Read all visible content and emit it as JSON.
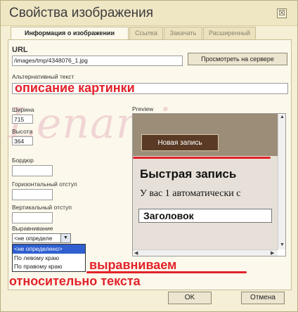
{
  "dialog": {
    "title": "Свойства изображения",
    "close_glyph": "☒"
  },
  "tabs": [
    {
      "label": "Информация о изображении",
      "active": true
    },
    {
      "label": "Ссылка",
      "active": false
    },
    {
      "label": "Закачать",
      "active": false
    },
    {
      "label": "Расширенный",
      "active": false
    }
  ],
  "url": {
    "label": "URL",
    "value": "/images/tmp/4348076_1.jpg",
    "browse_label": "Просмотреть на сервере"
  },
  "alt": {
    "label": "Альтернативный текст",
    "annotation": "описание картинки"
  },
  "size": {
    "width_label": "Ширина",
    "width_value": "715",
    "height_label": "Высота",
    "height_value": "364"
  },
  "fields": {
    "border_label": "Бордюр",
    "hspace_label": "Горизонтальный отступ",
    "vspace_label": "Вертикальный отступ"
  },
  "align": {
    "label": "Выравнивание",
    "selected": "<не определе",
    "options": [
      "<не определено>",
      "По левому краю",
      "По правому краю"
    ]
  },
  "preview": {
    "label": "Preview",
    "button_text": "Новая запись",
    "heading": "Быстрая запись",
    "text": "У вас 1 автоматически с",
    "subheading": "Заголовок"
  },
  "watermark": "Lenamix.ru",
  "annotations": {
    "line1": "выравниваем",
    "line2": "относительно текста"
  },
  "buttons": {
    "ok": "OK",
    "cancel": "Отмена"
  }
}
